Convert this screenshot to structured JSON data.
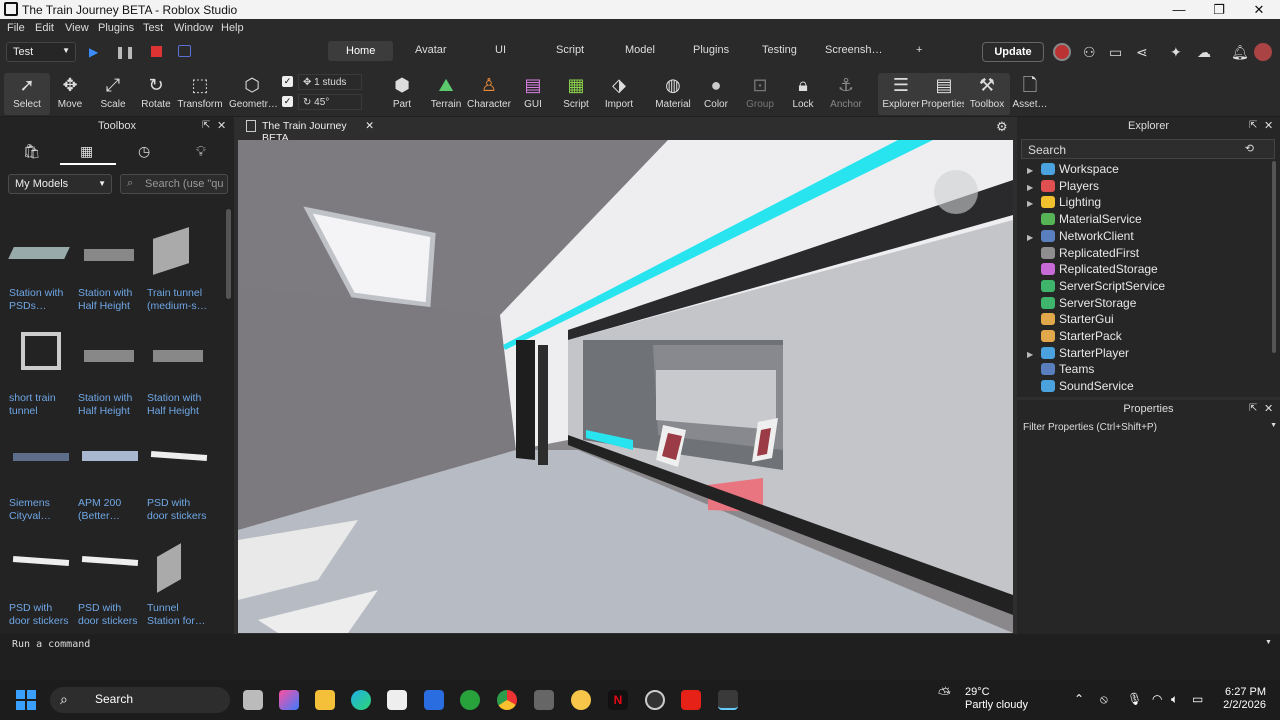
{
  "window": {
    "title": "The Train Journey BETA - Roblox Studio",
    "controls": {
      "minimize": "—",
      "maximize": "❐",
      "close": "✕"
    }
  },
  "menu": [
    "File",
    "Edit",
    "View",
    "Plugins",
    "Test",
    "Window",
    "Help"
  ],
  "tabs": {
    "context": "Test",
    "items": [
      "Home",
      "Avatar",
      "UI",
      "Script",
      "Model",
      "Plugins",
      "Testing",
      "Screensh…",
      "+"
    ],
    "active": "Home",
    "update_label": "Update"
  },
  "ribbon": {
    "tools": [
      {
        "label": "Select",
        "icon": "cursor-icon"
      },
      {
        "label": "Move",
        "icon": "move-icon"
      },
      {
        "label": "Scale",
        "icon": "scale-icon"
      },
      {
        "label": "Rotate",
        "icon": "rotate-icon"
      },
      {
        "label": "Transform",
        "icon": "transform-icon"
      },
      {
        "label": "Geometr…",
        "icon": "geometry-icon"
      }
    ],
    "move_step": "1 studs",
    "rotate_step": "45°",
    "insert": [
      {
        "label": "Part",
        "icon": "part-icon"
      },
      {
        "label": "Terrain",
        "icon": "terrain-icon"
      },
      {
        "label": "Character",
        "icon": "character-icon"
      },
      {
        "label": "GUI",
        "icon": "gui-icon"
      },
      {
        "label": "Script",
        "icon": "script-icon"
      },
      {
        "label": "Import",
        "icon": "import-icon"
      },
      {
        "label": "Material",
        "icon": "material-icon"
      },
      {
        "label": "Color",
        "icon": "color-icon"
      },
      {
        "label": "Group",
        "icon": "group-icon"
      },
      {
        "label": "Lock",
        "icon": "lock-icon"
      },
      {
        "label": "Anchor",
        "icon": "anchor-icon"
      },
      {
        "label": "Explorer",
        "icon": "explorer-icon"
      },
      {
        "label": "Properties",
        "icon": "properties-icon"
      },
      {
        "label": "Toolbox",
        "icon": "toolbox-icon"
      },
      {
        "label": "Asset…",
        "icon": "asset-icon"
      }
    ]
  },
  "toolbox": {
    "title": "Toolbox",
    "category": "My Models",
    "search_placeholder": "Search (use \"qu",
    "models": [
      {
        "name": "Station with PSDs…"
      },
      {
        "name": "Station with Half Height"
      },
      {
        "name": "Train tunnel (medium-s…"
      },
      {
        "name": "short train tunnel"
      },
      {
        "name": "Station with Half Height"
      },
      {
        "name": "Station with Half Height"
      },
      {
        "name": "Siemens Cityval…"
      },
      {
        "name": "APM 200 (Better…"
      },
      {
        "name": "PSD with door stickers"
      },
      {
        "name": "PSD with door stickers"
      },
      {
        "name": "PSD with door stickers"
      },
      {
        "name": "Tunnel Station for…"
      }
    ]
  },
  "document_tab": {
    "label": "The Train Journey BETA",
    "close": "✕"
  },
  "explorer": {
    "title": "Explorer",
    "search": "Search",
    "items": [
      {
        "name": "Workspace",
        "expandable": true,
        "color": "#4aa3df"
      },
      {
        "name": "Players",
        "expandable": true,
        "color": "#e05050"
      },
      {
        "name": "Lighting",
        "expandable": true,
        "color": "#f2c12e"
      },
      {
        "name": "MaterialService",
        "expandable": false,
        "color": "#56b356"
      },
      {
        "name": "NetworkClient",
        "expandable": true,
        "color": "#5a7fbf"
      },
      {
        "name": "ReplicatedFirst",
        "expandable": false,
        "color": "#8e8e8e"
      },
      {
        "name": "ReplicatedStorage",
        "expandable": false,
        "color": "#c66bd6"
      },
      {
        "name": "ServerScriptService",
        "expandable": false,
        "color": "#3fb56b"
      },
      {
        "name": "ServerStorage",
        "expandable": false,
        "color": "#3fb56b"
      },
      {
        "name": "StarterGui",
        "expandable": false,
        "color": "#e0a84a"
      },
      {
        "name": "StarterPack",
        "expandable": false,
        "color": "#e0a84a"
      },
      {
        "name": "StarterPlayer",
        "expandable": true,
        "color": "#4aa3df"
      },
      {
        "name": "Teams",
        "expandable": false,
        "color": "#5a7fbf"
      },
      {
        "name": "SoundService",
        "expandable": false,
        "color": "#4aa3df"
      }
    ]
  },
  "properties": {
    "title": "Properties",
    "filter": "Filter Properties (Ctrl+Shift+P)"
  },
  "command_bar": {
    "placeholder": "Run a command"
  },
  "taskbar": {
    "search": "Search",
    "weather": {
      "temp": "29°C",
      "condition": "Partly cloudy"
    },
    "time": "6:27 PM",
    "date": "2/2/2026"
  }
}
